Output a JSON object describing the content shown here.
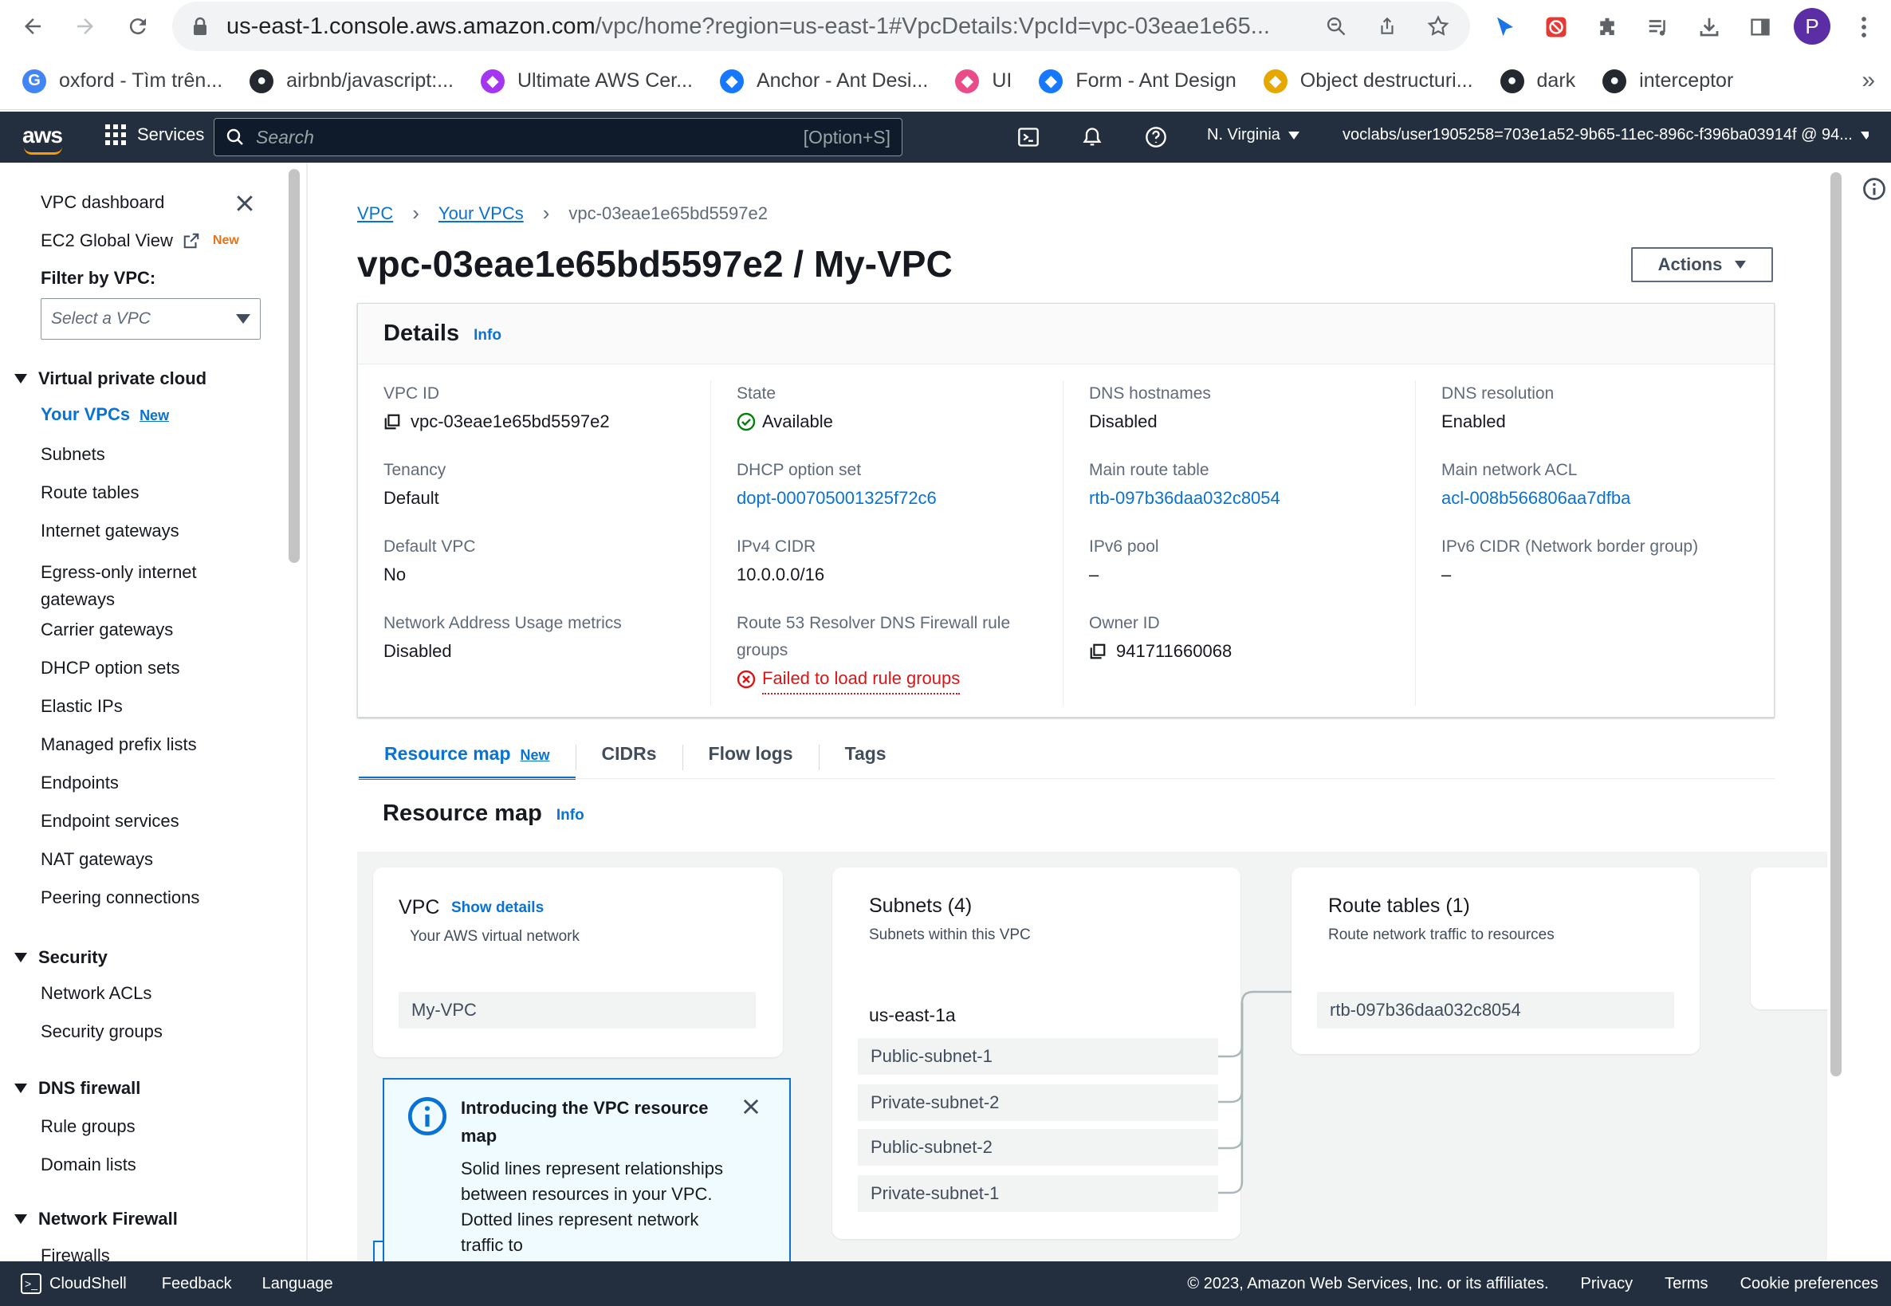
{
  "browser": {
    "url_host": "us-east-1.console.aws.amazon.com",
    "url_path": "/vpc/home?region=us-east-1#VpcDetails:VpcId=vpc-03eae1e65...",
    "profile_initial": "P",
    "bookmarks": [
      {
        "label": "oxford - Tìm trên...",
        "icon": "google-icon",
        "color": "#4285f4"
      },
      {
        "label": "airbnb/javascript:...",
        "icon": "github-icon",
        "color": "#24292f"
      },
      {
        "label": "Ultimate AWS Cer...",
        "icon": "udemy-icon",
        "color": "#a435f0"
      },
      {
        "label": "Anchor - Ant Desi...",
        "icon": "ant-design-icon",
        "color": "#1677ff"
      },
      {
        "label": "UI",
        "icon": "dribbble-icon",
        "color": "#ea4c89"
      },
      {
        "label": "Form - Ant Design",
        "icon": "ant-design-icon",
        "color": "#1677ff"
      },
      {
        "label": "Object destructuri...",
        "icon": "js-info-icon",
        "color": "#e6a700"
      },
      {
        "label": "dark",
        "icon": "github-icon",
        "color": "#24292f"
      },
      {
        "label": "interceptor",
        "icon": "github-icon",
        "color": "#24292f"
      }
    ],
    "more": "»"
  },
  "header": {
    "logo": "aws",
    "services": "Services",
    "search_placeholder": "Search",
    "search_shortcut": "[Option+S]",
    "region": "N. Virginia",
    "account": "voclabs/user1905258=703e1a52-9b65-11ec-896c-f396ba03914f @ 94..."
  },
  "sidebar": {
    "top_items": [
      {
        "label": "VPC dashboard"
      },
      {
        "label": "EC2 Global View",
        "badge": "New"
      }
    ],
    "filter_label": "Filter by VPC:",
    "filter_placeholder": "Select a VPC",
    "sections": [
      {
        "title": "Virtual private cloud",
        "items": [
          "Your VPCs",
          "Subnets",
          "Route tables",
          "Internet gateways",
          "Egress-only internet gateways",
          "Carrier gateways",
          "DHCP option sets",
          "Elastic IPs",
          "Managed prefix lists",
          "Endpoints",
          "Endpoint services",
          "NAT gateways",
          "Peering connections"
        ],
        "active_badge": "New"
      },
      {
        "title": "Security",
        "items": [
          "Network ACLs",
          "Security groups"
        ]
      },
      {
        "title": "DNS firewall",
        "items": [
          "Rule groups",
          "Domain lists"
        ]
      },
      {
        "title": "Network Firewall",
        "items": [
          "Firewalls"
        ]
      }
    ]
  },
  "breadcrumb": {
    "root": "VPC",
    "parent": "Your VPCs",
    "current": "vpc-03eae1e65bd5597e2"
  },
  "page_title": "vpc-03eae1e65bd5597e2 / My-VPC",
  "actions_label": "Actions",
  "details": {
    "title": "Details",
    "info": "Info",
    "fields": {
      "vpc_id": {
        "label": "VPC ID",
        "value": "vpc-03eae1e65bd5597e2"
      },
      "tenancy": {
        "label": "Tenancy",
        "value": "Default"
      },
      "default_vpc": {
        "label": "Default VPC",
        "value": "No"
      },
      "nau_metrics": {
        "label": "Network Address Usage metrics",
        "value": "Disabled"
      },
      "state": {
        "label": "State",
        "value": "Available"
      },
      "dhcp": {
        "label": "DHCP option set",
        "value": "dopt-000705001325f72c6"
      },
      "ipv4": {
        "label": "IPv4 CIDR",
        "value": "10.0.0.0/16"
      },
      "r53": {
        "label": "Route 53 Resolver DNS Firewall rule",
        "label2": "groups",
        "value": "Failed to load rule groups"
      },
      "dns_hostnames": {
        "label": "DNS hostnames",
        "value": "Disabled"
      },
      "main_route": {
        "label": "Main route table",
        "value": "rtb-097b36daa032c8054"
      },
      "ipv6_pool": {
        "label": "IPv6 pool",
        "value": "–"
      },
      "owner": {
        "label": "Owner ID",
        "value": "941711660068"
      },
      "dns_resolution": {
        "label": "DNS resolution",
        "value": "Enabled"
      },
      "main_acl": {
        "label": "Main network ACL",
        "value": "acl-008b566806aa7dfba"
      },
      "ipv6_cidr": {
        "label": "IPv6 CIDR (Network border group)",
        "value": "–"
      }
    },
    "colors": {
      "ok": "#037f0c",
      "error": "#d91515",
      "link": "#0972d3"
    }
  },
  "tabs": [
    {
      "label": "Resource map",
      "badge": "New",
      "active": true
    },
    {
      "label": "CIDRs"
    },
    {
      "label": "Flow logs"
    },
    {
      "label": "Tags"
    }
  ],
  "resource_map": {
    "title": "Resource map",
    "info": "Info",
    "vpc": {
      "title": "VPC",
      "show_details": "Show details",
      "subtitle": "Your AWS virtual network",
      "node": "My-VPC"
    },
    "subnets": {
      "title": "Subnets (4)",
      "subtitle": "Subnets within this VPC",
      "az": "us-east-1a",
      "nodes": [
        "Public-subnet-1",
        "Private-subnet-2",
        "Public-subnet-2",
        "Private-subnet-1"
      ]
    },
    "route_tables": {
      "title": "Route tables (1)",
      "subtitle": "Route network traffic to resources",
      "node": "rtb-097b36daa032c8054"
    },
    "intro": {
      "title": "Introducing the VPC resource map",
      "body": "Solid lines represent relationships between resources in your VPC. Dotted lines represent network traffic to"
    }
  },
  "footer": {
    "cloudshell": "CloudShell",
    "feedback": "Feedback",
    "language": "Language",
    "copyright": "© 2023, Amazon Web Services, Inc. or its affiliates.",
    "privacy": "Privacy",
    "terms": "Terms",
    "cookies": "Cookie preferences"
  }
}
